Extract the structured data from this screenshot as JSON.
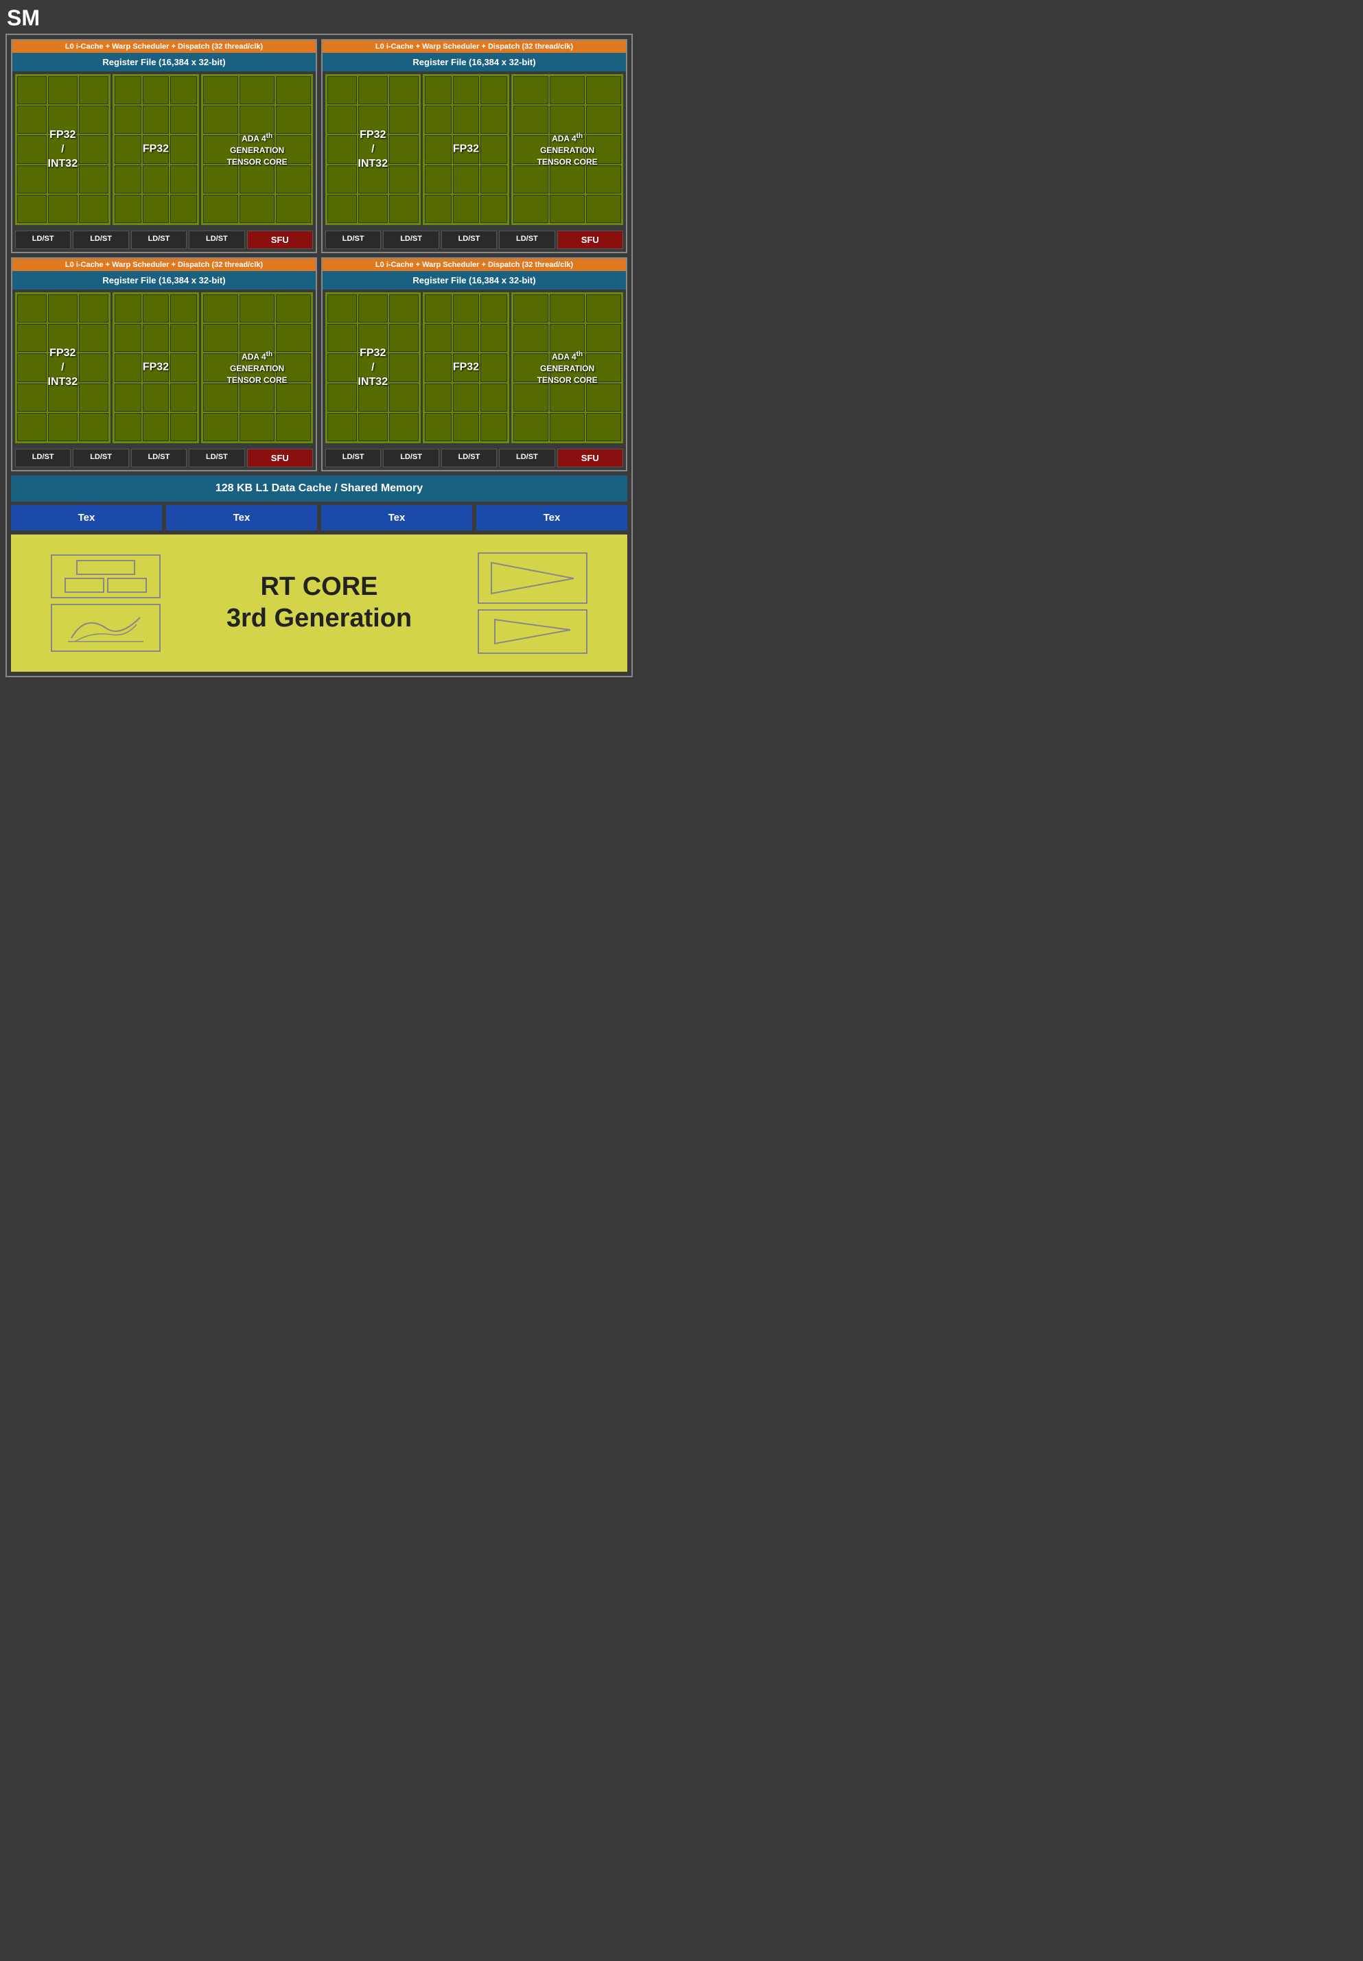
{
  "title": "SM",
  "quadrants": [
    {
      "id": "q1",
      "l0_label": "L0 i-Cache + Warp Scheduler + Dispatch (32 thread/clk)",
      "reg_label": "Register File (16,384 x 32-bit)",
      "fp32_int32_label": "FP32\n/\nINT32",
      "fp32_label": "FP32",
      "tensor_label": "ADA 4th\nGENERATION\nTENSOR CORE",
      "ldst_labels": [
        "LD/ST",
        "LD/ST",
        "LD/ST",
        "LD/ST"
      ],
      "sfu_label": "SFU"
    },
    {
      "id": "q2",
      "l0_label": "L0 i-Cache + Warp Scheduler + Dispatch (32 thread/clk)",
      "reg_label": "Register File (16,384 x 32-bit)",
      "fp32_int32_label": "FP32\n/\nINT32",
      "fp32_label": "FP32",
      "tensor_label": "ADA 4th\nGENERATION\nTENSOR CORE",
      "ldst_labels": [
        "LD/ST",
        "LD/ST",
        "LD/ST",
        "LD/ST"
      ],
      "sfu_label": "SFU"
    },
    {
      "id": "q3",
      "l0_label": "L0 i-Cache + Warp Scheduler + Dispatch (32 thread/clk)",
      "reg_label": "Register File (16,384 x 32-bit)",
      "fp32_int32_label": "FP32\n/\nINT32",
      "fp32_label": "FP32",
      "tensor_label": "ADA 4th\nGENERATION\nTENSOR CORE",
      "ldst_labels": [
        "LD/ST",
        "LD/ST",
        "LD/ST",
        "LD/ST"
      ],
      "sfu_label": "SFU"
    },
    {
      "id": "q4",
      "l0_label": "L0 i-Cache + Warp Scheduler + Dispatch (32 thread/clk)",
      "reg_label": "Register File (16,384 x 32-bit)",
      "fp32_int32_label": "FP32\n/\nINT32",
      "fp32_label": "FP32",
      "tensor_label": "ADA 4th\nGENERATION\nTENSOR CORE",
      "ldst_labels": [
        "LD/ST",
        "LD/ST",
        "LD/ST",
        "LD/ST"
      ],
      "sfu_label": "SFU"
    }
  ],
  "l1_cache_label": "128 KB L1 Data Cache / Shared Memory",
  "tex_labels": [
    "Tex",
    "Tex",
    "Tex",
    "Tex"
  ],
  "rt_core": {
    "label_line1": "RT CORE",
    "label_line2": "3rd Generation"
  }
}
